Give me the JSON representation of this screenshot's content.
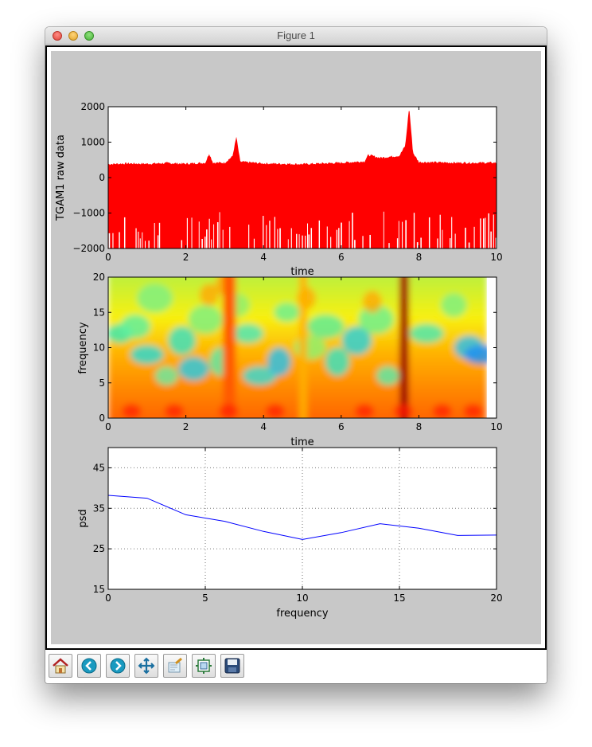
{
  "window": {
    "title": "Figure 1"
  },
  "toolbar": {
    "buttons": [
      {
        "name": "home",
        "icon": "home-icon"
      },
      {
        "name": "back",
        "icon": "back-arrow-icon"
      },
      {
        "name": "forward",
        "icon": "forward-arrow-icon"
      },
      {
        "name": "pan",
        "icon": "move-arrows-icon"
      },
      {
        "name": "zoom",
        "icon": "zoom-rect-icon"
      },
      {
        "name": "subplots",
        "icon": "subplots-config-icon"
      },
      {
        "name": "save",
        "icon": "floppy-disk-icon"
      }
    ]
  },
  "colors": {
    "raw": "#ff0000",
    "psd": "#0000ff",
    "figure_bg": "#c8c8c8"
  },
  "chart_data": [
    {
      "type": "area",
      "description_free": true,
      "xlabel": "time",
      "ylabel": "TGAM1 raw data",
      "xlim": [
        0,
        10
      ],
      "ylim": [
        -2000,
        2000
      ],
      "xticks": [
        "0",
        "2",
        "4",
        "6",
        "8",
        "10"
      ],
      "yticks": [
        "−2000",
        "−1000",
        "0",
        "1000",
        "2000"
      ],
      "series": [
        {
          "color": "#ff0000",
          "upper_envelope": [
            [
              0,
              380
            ],
            [
              0.5,
              400
            ],
            [
              1,
              390
            ],
            [
              1.5,
              410
            ],
            [
              2,
              390
            ],
            [
              2.5,
              420
            ],
            [
              2.6,
              680
            ],
            [
              2.7,
              420
            ],
            [
              3,
              420
            ],
            [
              3.2,
              600
            ],
            [
              3.3,
              1150
            ],
            [
              3.4,
              450
            ],
            [
              4,
              400
            ],
            [
              5,
              380
            ],
            [
              6,
              420
            ],
            [
              6.6,
              460
            ],
            [
              6.7,
              640
            ],
            [
              7,
              560
            ],
            [
              7.5,
              620
            ],
            [
              7.65,
              900
            ],
            [
              7.75,
              2000
            ],
            [
              7.85,
              700
            ],
            [
              8,
              440
            ],
            [
              9,
              420
            ],
            [
              10,
              420
            ]
          ]
        }
      ]
    },
    {
      "type": "heatmap",
      "xlabel": "time",
      "ylabel": "frequency",
      "xlim": [
        0,
        10
      ],
      "ylim": [
        0,
        20
      ],
      "xticks": [
        "0",
        "2",
        "4",
        "6",
        "8",
        "10"
      ],
      "yticks": [
        "0",
        "5",
        "10",
        "15",
        "20"
      ],
      "colormap": "jet",
      "data_extent_x": [
        0,
        9.75
      ],
      "hot_columns_time": [
        3.1,
        5.0,
        7.6
      ],
      "hot_rows_frequency_below": 4.5
    },
    {
      "type": "line",
      "xlabel": "frequency",
      "ylabel": "psd",
      "xlim": [
        0,
        20
      ],
      "ylim": [
        15,
        50
      ],
      "grid": true,
      "xticks": [
        "0",
        "5",
        "10",
        "15",
        "20"
      ],
      "yticks": [
        "15",
        "25",
        "35",
        "45"
      ],
      "series": [
        {
          "color": "#0000ff",
          "x": [
            0,
            2,
            4,
            6,
            8,
            10,
            12,
            14,
            16,
            18,
            20
          ],
          "y": [
            38.2,
            37.5,
            33.4,
            31.8,
            29.3,
            27.3,
            29.0,
            31.2,
            30.1,
            28.3,
            28.4
          ]
        }
      ]
    }
  ]
}
